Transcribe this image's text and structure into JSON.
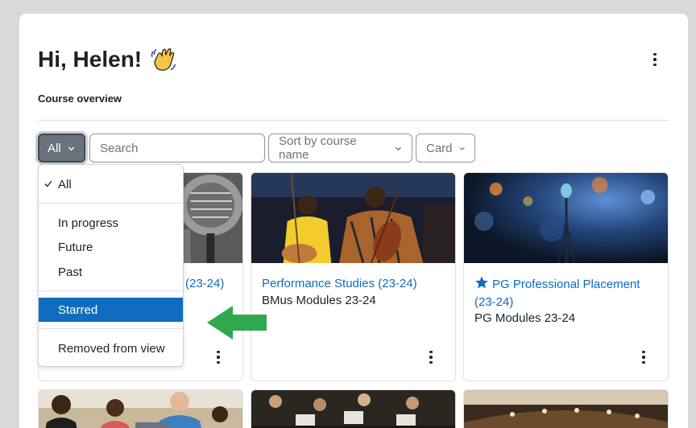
{
  "header": {
    "greeting": "Hi, Helen!",
    "greeting_emoji_icon": "waving-hand-icon"
  },
  "course_overview": {
    "title": "Course overview",
    "filter": {
      "label": "All"
    },
    "search": {
      "placeholder": "Search"
    },
    "sort": {
      "label": "Sort by course name"
    },
    "view": {
      "label": "Card"
    },
    "filter_menu": {
      "items": [
        "All",
        "In progress",
        "Future",
        "Past",
        "Starred",
        "Removed from view"
      ],
      "selected": "All",
      "highlighted": "Starred"
    }
  },
  "courses": [
    {
      "title": "(23-24)",
      "category": "",
      "starred": false
    },
    {
      "title": "Performance Studies (23-24)",
      "category": "BMus Modules 23-24",
      "starred": false
    },
    {
      "title": "PG Professional Placement (23-24)",
      "category": "PG Modules 23-24",
      "starred": true
    }
  ],
  "colors": {
    "accent": "#0f6cbf",
    "filter_button": "#6a737b",
    "arrow": "#2fa84f"
  }
}
